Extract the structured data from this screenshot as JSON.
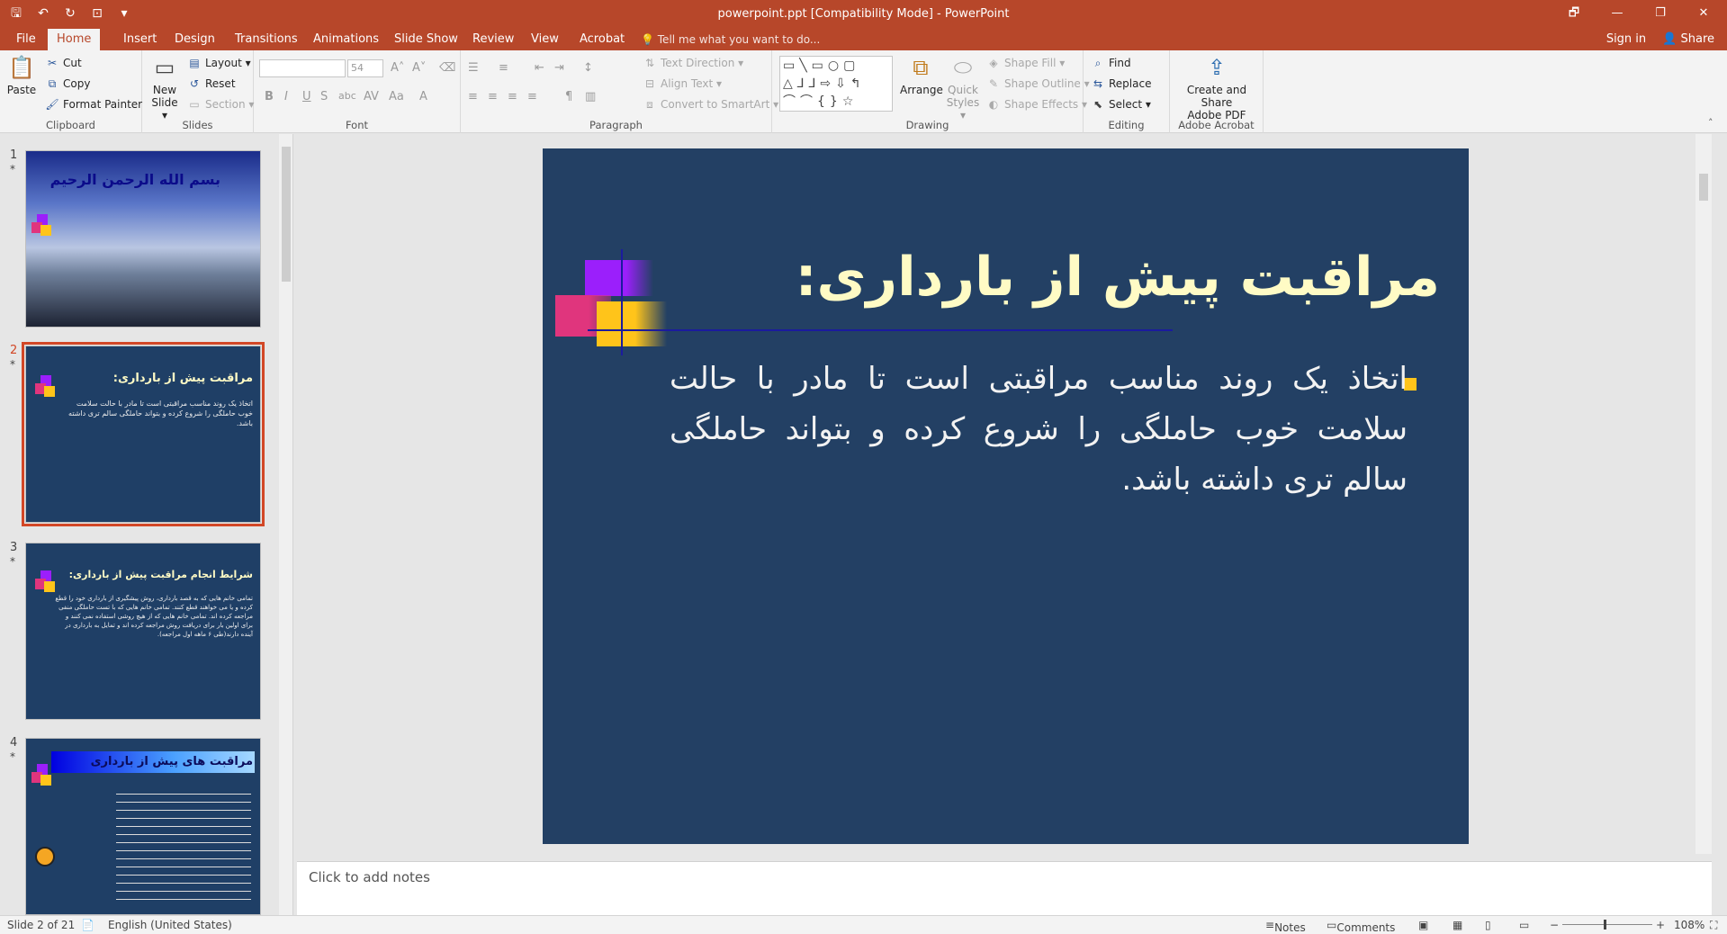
{
  "window": {
    "title": "powerpoint.ppt [Compatibility Mode] - PowerPoint",
    "controls": [
      "🗗",
      "—",
      "❐",
      "✕"
    ]
  },
  "tabs": {
    "items": [
      "File",
      "Home",
      "Insert",
      "Design",
      "Transitions",
      "Animations",
      "Slide Show",
      "Review",
      "View",
      "Acrobat"
    ],
    "active": "Home",
    "tell_me": "Tell me what you want to do...",
    "sign_in": "Sign in",
    "share": "Share"
  },
  "ribbon": {
    "clipboard": {
      "label": "Clipboard",
      "paste": "Paste",
      "cut": "Cut",
      "copy": "Copy",
      "format_painter": "Format Painter"
    },
    "slides": {
      "label": "Slides",
      "new_slide": "New",
      "new_slide_2": "Slide ▾",
      "layout": "Layout ▾",
      "reset": "Reset",
      "section": "Section ▾"
    },
    "font": {
      "label": "Font",
      "font_name": "",
      "font_size": "54"
    },
    "paragraph": {
      "label": "Paragraph",
      "text_direction": "Text Direction ▾",
      "align_text": "Align Text ▾",
      "convert_smartart": "Convert to SmartArt ▾"
    },
    "drawing": {
      "label": "Drawing",
      "arrange": "Arrange",
      "quick_styles": "Quick",
      "quick_styles_2": "Styles ▾",
      "shape_fill": "Shape Fill ▾",
      "shape_outline": "Shape Outline ▾",
      "shape_effects": "Shape Effects ▾"
    },
    "editing": {
      "label": "Editing",
      "find": "Find",
      "replace": "Replace",
      "select": "Select ▾"
    },
    "acrobat": {
      "label": "Adobe Acrobat",
      "create_share": "Create and Share",
      "create_share_2": "Adobe PDF"
    }
  },
  "thumbnails": [
    {
      "number": "1",
      "title": "بسم الله الرحمن الرحیم",
      "body": ""
    },
    {
      "number": "2",
      "title": "مراقبت پیش از بارداری:",
      "body": "اتخاذ یک روند مناسب مراقبتی است تا مادر با حالت سلامت خوب حاملگی را شروع کرده و بتواند حاملگی سالم تری داشته باشد."
    },
    {
      "number": "3",
      "title": "شرایط انجام مراقبت پیش از بارداری:",
      "body": "تمامی خانم هایی که به قصد بارداری، روش پیشگیری از بارداری خود را قطع کرده و یا می خواهند قطع کنند. تمامی خانم هایی که با تست حاملگی منفی مراجعه کرده اند. تمامی خانم هایی که از هیچ روشی استفاده نمی کنند و برای اولین بار برای دریافت روش مراجعه کرده اند و تمایل به بارداری در آینده دارند(طی ۶ ماهه اول مراجعه)."
    },
    {
      "number": "4",
      "title": "مراقبت های پیش از بارداری",
      "body": ""
    }
  ],
  "slide": {
    "title": "مراقبت پیش از بارداری:",
    "body": "اتخاذ یک روند مناسب مراقبتی است تا مادر با حالت سلامت خوب حاملگی را شروع کرده و بتواند حاملگی سالم تری داشته باشد."
  },
  "notes": {
    "placeholder": "Click to add notes"
  },
  "status": {
    "slide_indicator": "Slide 2 of 21",
    "language": "English (United States)",
    "notes": "Notes",
    "comments": "Comments",
    "zoom": "108%"
  },
  "colors": {
    "accent": "#b7472a",
    "slide_background": "#234064",
    "slide_title": "#fffbc5",
    "bullet": "#ffc41a"
  }
}
